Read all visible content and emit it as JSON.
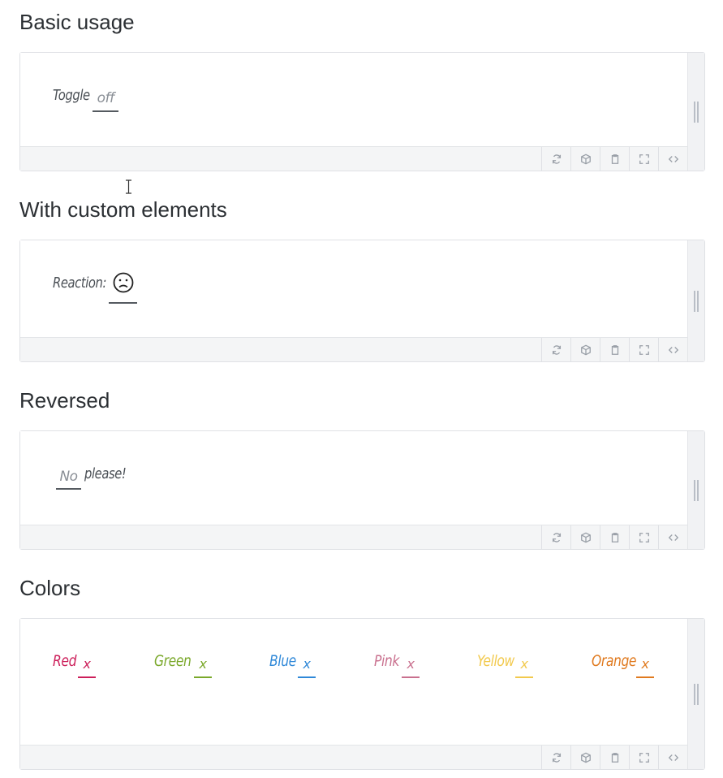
{
  "sections": [
    {
      "title": "Basic usage",
      "label": "Toggle",
      "toggle_value": "off"
    },
    {
      "title": "With custom elements",
      "label": "Reaction:",
      "face": "frown-face-icon"
    },
    {
      "title": "Reversed",
      "toggle_value": "No",
      "label": "please!"
    },
    {
      "title": "Colors"
    }
  ],
  "colors": [
    {
      "label": "Red",
      "value": "x",
      "color": "#cc1f5a"
    },
    {
      "label": "Green",
      "value": "x",
      "color": "#7aa82a"
    },
    {
      "label": "Blue",
      "value": "x",
      "color": "#2f88d8"
    },
    {
      "label": "Pink",
      "value": "x",
      "color": "#c9708e"
    },
    {
      "label": "Yellow",
      "value": "x",
      "color": "#f2c94c"
    },
    {
      "label": "Orange",
      "value": "x",
      "color": "#e07a1f"
    }
  ],
  "toolbar_icons": [
    "refresh-icon",
    "package-icon",
    "clipboard-icon",
    "fullscreen-icon",
    "code-icon"
  ]
}
